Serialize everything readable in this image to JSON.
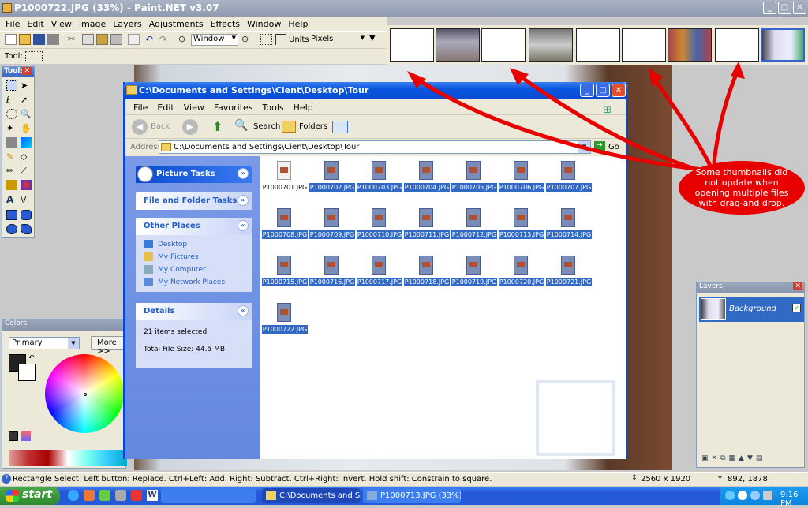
{
  "window": {
    "title": "P1000722.JPG (33%) - Paint.NET v3.07"
  },
  "menu": [
    "File",
    "Edit",
    "View",
    "Image",
    "Layers",
    "Adjustments",
    "Effects",
    "Window",
    "Help"
  ],
  "toolbar": {
    "zoom_mode": "Window",
    "units_label": "Units:",
    "units_value": "Pixels",
    "tool_label": "Tool:"
  },
  "tools_window": {
    "title": "Tools"
  },
  "colors_window": {
    "title": "Colors",
    "mode": "Primary",
    "more_label": "More >>"
  },
  "layers_window": {
    "title": "Layers",
    "layer_name": "Background"
  },
  "explorer": {
    "title": "C:\\Documents and Settings\\Cient\\Desktop\\Tour",
    "menu": [
      "File",
      "Edit",
      "View",
      "Favorites",
      "Tools",
      "Help"
    ],
    "back_label": "Back",
    "search_label": "Search",
    "folders_label": "Folders",
    "address_label": "Address",
    "address_value": "C:\\Documents and Settings\\Cient\\Desktop\\Tour",
    "go_label": "Go",
    "picture_tasks": "Picture Tasks",
    "file_folder_tasks": "File and Folder Tasks",
    "other_places": {
      "title": "Other Places",
      "items": [
        "Desktop",
        "My Pictures",
        "My Computer",
        "My Network Places"
      ]
    },
    "details": {
      "title": "Details",
      "selected": "21 items selected.",
      "size": "Total File Size: 44.5 MB"
    },
    "files": [
      "P1000701.JPG",
      "P1000702.JPG",
      "P1000703.JPG",
      "P1000704.JPG",
      "P1000705.JPG",
      "P1000706.JPG",
      "P1000707.JPG",
      "P1000708.JPG",
      "P1000709.JPG",
      "P1000710.JPG",
      "P1000711.JPG",
      "P1000712.JPG",
      "P1000713.JPG",
      "P1000714.JPG",
      "P1000715.JPG",
      "P1000716.JPG",
      "P1000717.JPG",
      "P1000718.JPG",
      "P1000719.JPG",
      "P1000720.JPG",
      "P1000721.JPG",
      "P1000722.JPG"
    ]
  },
  "annotation": {
    "text": "Some thumbnails did not update when opening multiple files with drag-and drop.",
    "color": "#e80000"
  },
  "status": {
    "hint": "Rectangle Select: Left button: Replace. Ctrl+Left: Add. Right: Subtract. Ctrl+Right: Invert. Hold shift: Constrain to square.",
    "image_size": "2560 x 1920",
    "cursor_pos": "892, 1878"
  },
  "taskbar": {
    "start_label": "start",
    "tasks": [
      "C:\\Documents and Se...",
      "P1000713.JPG (33%)..."
    ],
    "clock": "9:16 PM"
  }
}
